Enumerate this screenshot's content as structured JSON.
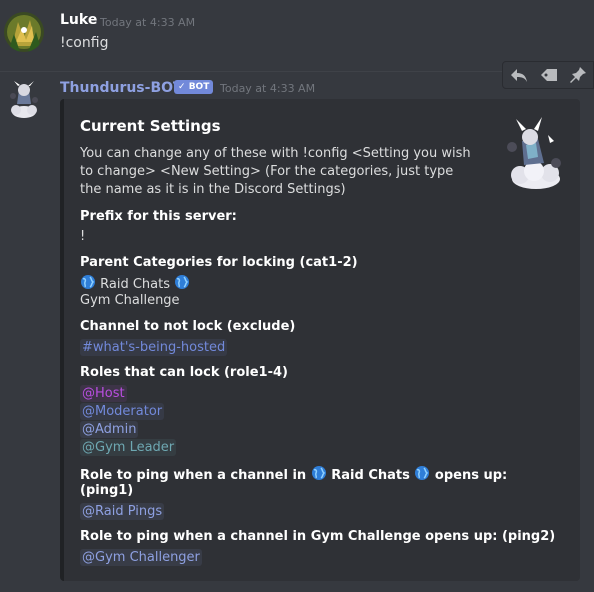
{
  "messages": [
    {
      "author": "Luke",
      "timestamp": "Today at 4:33 AM",
      "content": "!config"
    },
    {
      "author": "Thundurus-BOT",
      "bot_tag": "BOT",
      "timestamp": "Today at 4:33 AM"
    }
  ],
  "toolbar": {
    "actions": [
      "reply-icon",
      "tag-icon",
      "pin-icon"
    ]
  },
  "embed": {
    "title": "Current Settings",
    "description": "You can change any of these with !config <Setting you wish to change> <New Setting> (For the categories, just type the name as it is in the Discord Settings)",
    "fields": {
      "prefix_name": "Prefix for this server:",
      "prefix_value": "!",
      "parent_name": "Parent Categories for locking (cat1-2)",
      "parent_value_1": "Raid Chats",
      "parent_value_2": "Gym Challenge",
      "exclude_name": "Channel to not lock (exclude)",
      "exclude_value": "#what's-being-hosted",
      "roles_name": "Roles that can lock (role1-4)",
      "roles": [
        "@Host",
        "@Moderator",
        "@Admin",
        "@Gym Leader"
      ],
      "ping1_name_pre": "Role to ping when a channel in",
      "ping1_name_mid": "Raid Chats",
      "ping1_name_post": "opens up:",
      "ping1_name_line2": "(ping1)",
      "ping1_value": "@Raid Pings",
      "ping2_name": "Role to ping when a channel in Gym Challenge opens up: (ping2)",
      "ping2_value": "@Gym Challenger"
    }
  },
  "colors": {
    "background": "#36393f",
    "embed_bg": "#2f3136",
    "username_luke": "#ffffff",
    "username_bot": "#8ea0e1",
    "bot_tag": "#7289da",
    "mention_channel": "#7289da",
    "mention_host": "#b94ee0",
    "mention_moderator": "#7289da",
    "mention_admin": "#8ea0e1",
    "mention_gym_leader": "#6ea8b2",
    "mention_raid_pings": "#8ea0e1",
    "mention_gym_challenger": "#8ea0e1"
  }
}
